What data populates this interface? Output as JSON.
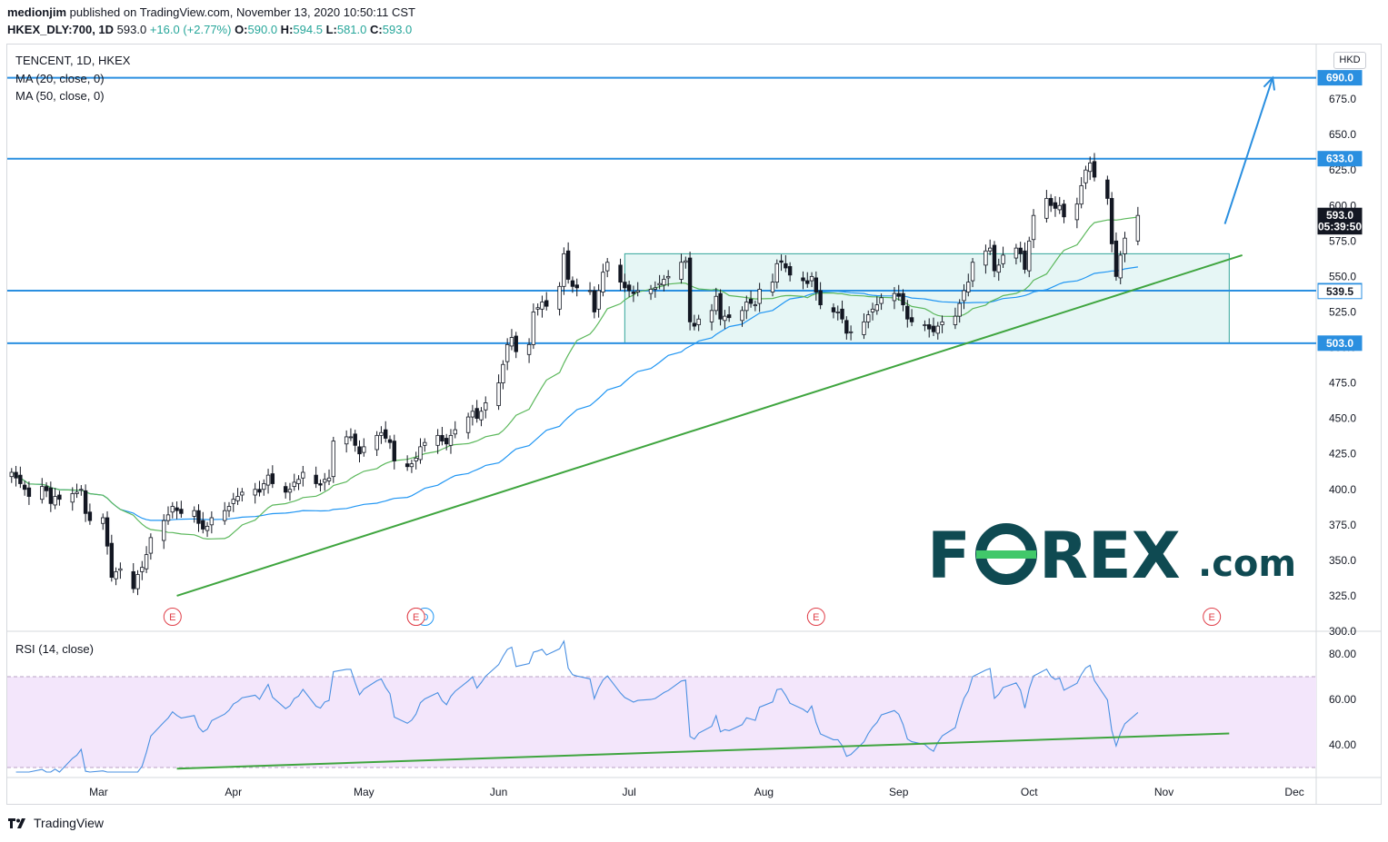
{
  "header": {
    "author": "medionjim",
    "published": " published on TradingView.com, November 13, 2020 10:50:11 CST",
    "symbol": "HKEX_DLY:700, 1D",
    "last": " 593.0 ",
    "change": "+16.0 (+2.77%)",
    "o_label": " O:",
    "o": "590.0",
    "h_label": " H:",
    "h": "594.5",
    "l_label": " L:",
    "l": "581.0",
    "c_label": " C:",
    "c": "593.0"
  },
  "legend": {
    "instrument": "TENCENT, 1D, HKEX",
    "ma20": "MA (20, close, 0)",
    "ma50": "MA (50, close, 0)",
    "rsi": "RSI (14, close)"
  },
  "currency": "HKD",
  "watermark": {
    "text_pre": "F",
    "text_post": "REX",
    "suffix": ".com"
  },
  "footer": {
    "brand": "TradingView"
  },
  "colors": {
    "level_line": "#2a8fe0",
    "trend_line": "#3fa53f",
    "ma20": "#5cb85c",
    "ma50": "#2196f3",
    "rsi_line": "#4a90e2",
    "rsi_band": "#f3e6fb",
    "box_fill": "#e6f6f5",
    "box_stroke": "#33a59a",
    "candle_dark": "#131722",
    "earnings": "#e0404a",
    "brand_dark": "#0f4a52",
    "brand_green": "#41c86a"
  },
  "chart_data": [
    {
      "type": "candlestick",
      "title": "TENCENT, 1D, HKEX",
      "ylim": [
        300,
        700
      ],
      "ylabel_ticks": [
        300,
        325,
        350,
        375,
        400,
        425,
        450,
        475,
        500,
        525,
        550,
        575,
        600,
        625,
        650,
        675
      ],
      "x_ticks": [
        "Mar",
        "Apr",
        "May",
        "Jun",
        "Jul",
        "Aug",
        "Sep",
        "Oct",
        "Nov",
        "Dec"
      ],
      "x_tick_dates": [
        "2020-03-01",
        "2020-04-01",
        "2020-05-01",
        "2020-06-01",
        "2020-07-01",
        "2020-08-01",
        "2020-09-01",
        "2020-10-01",
        "2020-11-01",
        "2020-12-01"
      ],
      "x_range": [
        "2020-02-09",
        "2020-12-06"
      ],
      "levels": [
        {
          "value": 690.0,
          "label": "690.0"
        },
        {
          "value": 633.0,
          "label": "633.0"
        },
        {
          "value": 540.0,
          "label": "540.0"
        },
        {
          "value": 503.0,
          "label": "503.0"
        }
      ],
      "extra_labels": [
        {
          "value": 593.0,
          "label": "593.0",
          "style": "dark"
        },
        {
          "value": 585.0,
          "label": "05:39:50",
          "style": "dark"
        },
        {
          "value": 539.5,
          "label": "539.5",
          "style": "outline"
        }
      ],
      "range_box": {
        "from": "2020-06-30",
        "to": "2020-11-16",
        "low": 503,
        "high": 566
      },
      "trend_line": {
        "from": [
          "2020-03-19",
          325
        ],
        "to": [
          "2020-11-19",
          565
        ]
      },
      "projection_arrow": {
        "from": [
          "2020-11-15",
          587
        ],
        "to": [
          "2020-11-26",
          690
        ]
      },
      "earnings_dates": [
        "2020-03-18",
        "2020-05-13",
        "2020-08-13",
        "2020-11-12"
      ],
      "dividend_dates": [
        "2020-05-14"
      ],
      "earnings_label": "E",
      "dividend_label": "D",
      "close": [
        412,
        408,
        404,
        400,
        395,
        402,
        399,
        390,
        395,
        393,
        397,
        398,
        400,
        383,
        378,
        380,
        360,
        338,
        342,
        344,
        330,
        340,
        345,
        354,
        366,
        378,
        382,
        388,
        385,
        383,
        385,
        376,
        372,
        374,
        380,
        385,
        388,
        393,
        395,
        398,
        400,
        398,
        404,
        410,
        404,
        398,
        400,
        405,
        407,
        412,
        404,
        403,
        407,
        408,
        434,
        437,
        437,
        431,
        425,
        430,
        438,
        440,
        436,
        433,
        420,
        416,
        418,
        422,
        430,
        433,
        438,
        434,
        432,
        438,
        442,
        451,
        455,
        450,
        455,
        461,
        475,
        488,
        502,
        507,
        497,
        502,
        525,
        528,
        532,
        529,
        543,
        566,
        548,
        543,
        542,
        540,
        525,
        540,
        553,
        560,
        546,
        542,
        540,
        538,
        540,
        541,
        542,
        545,
        548,
        550,
        560,
        561,
        518,
        515,
        520,
        526,
        536,
        520,
        522,
        521,
        526,
        532,
        531,
        530,
        541,
        546,
        559,
        560,
        556,
        551,
        547,
        545,
        550,
        539,
        530,
        525,
        525,
        520,
        510,
        511,
        518,
        523,
        527,
        530,
        535,
        538,
        536,
        530,
        520,
        518,
        516,
        513,
        511,
        515,
        518,
        522,
        531,
        540,
        546,
        560,
        568,
        570,
        554,
        558,
        565,
        570,
        566,
        555,
        575,
        593,
        605,
        600,
        598,
        600,
        592,
        601,
        614,
        625,
        630,
        620,
        605,
        573,
        550,
        565,
        577,
        593
      ],
      "series": [
        {
          "name": "MA (20, close, 0)"
        },
        {
          "name": "MA (50, close, 0)"
        }
      ]
    },
    {
      "type": "line",
      "title": "RSI (14, close)",
      "ylim": [
        28,
        88
      ],
      "ylabel_ticks": [
        40.0,
        60.0,
        80.0
      ],
      "ylabel_tick_labels": [
        "40.00",
        "60.00",
        "80.00"
      ],
      "bands": [
        30,
        70
      ],
      "trend_line": {
        "from": [
          "2020-03-19",
          29.5
        ],
        "to": [
          "2020-11-16",
          45
        ]
      }
    }
  ]
}
